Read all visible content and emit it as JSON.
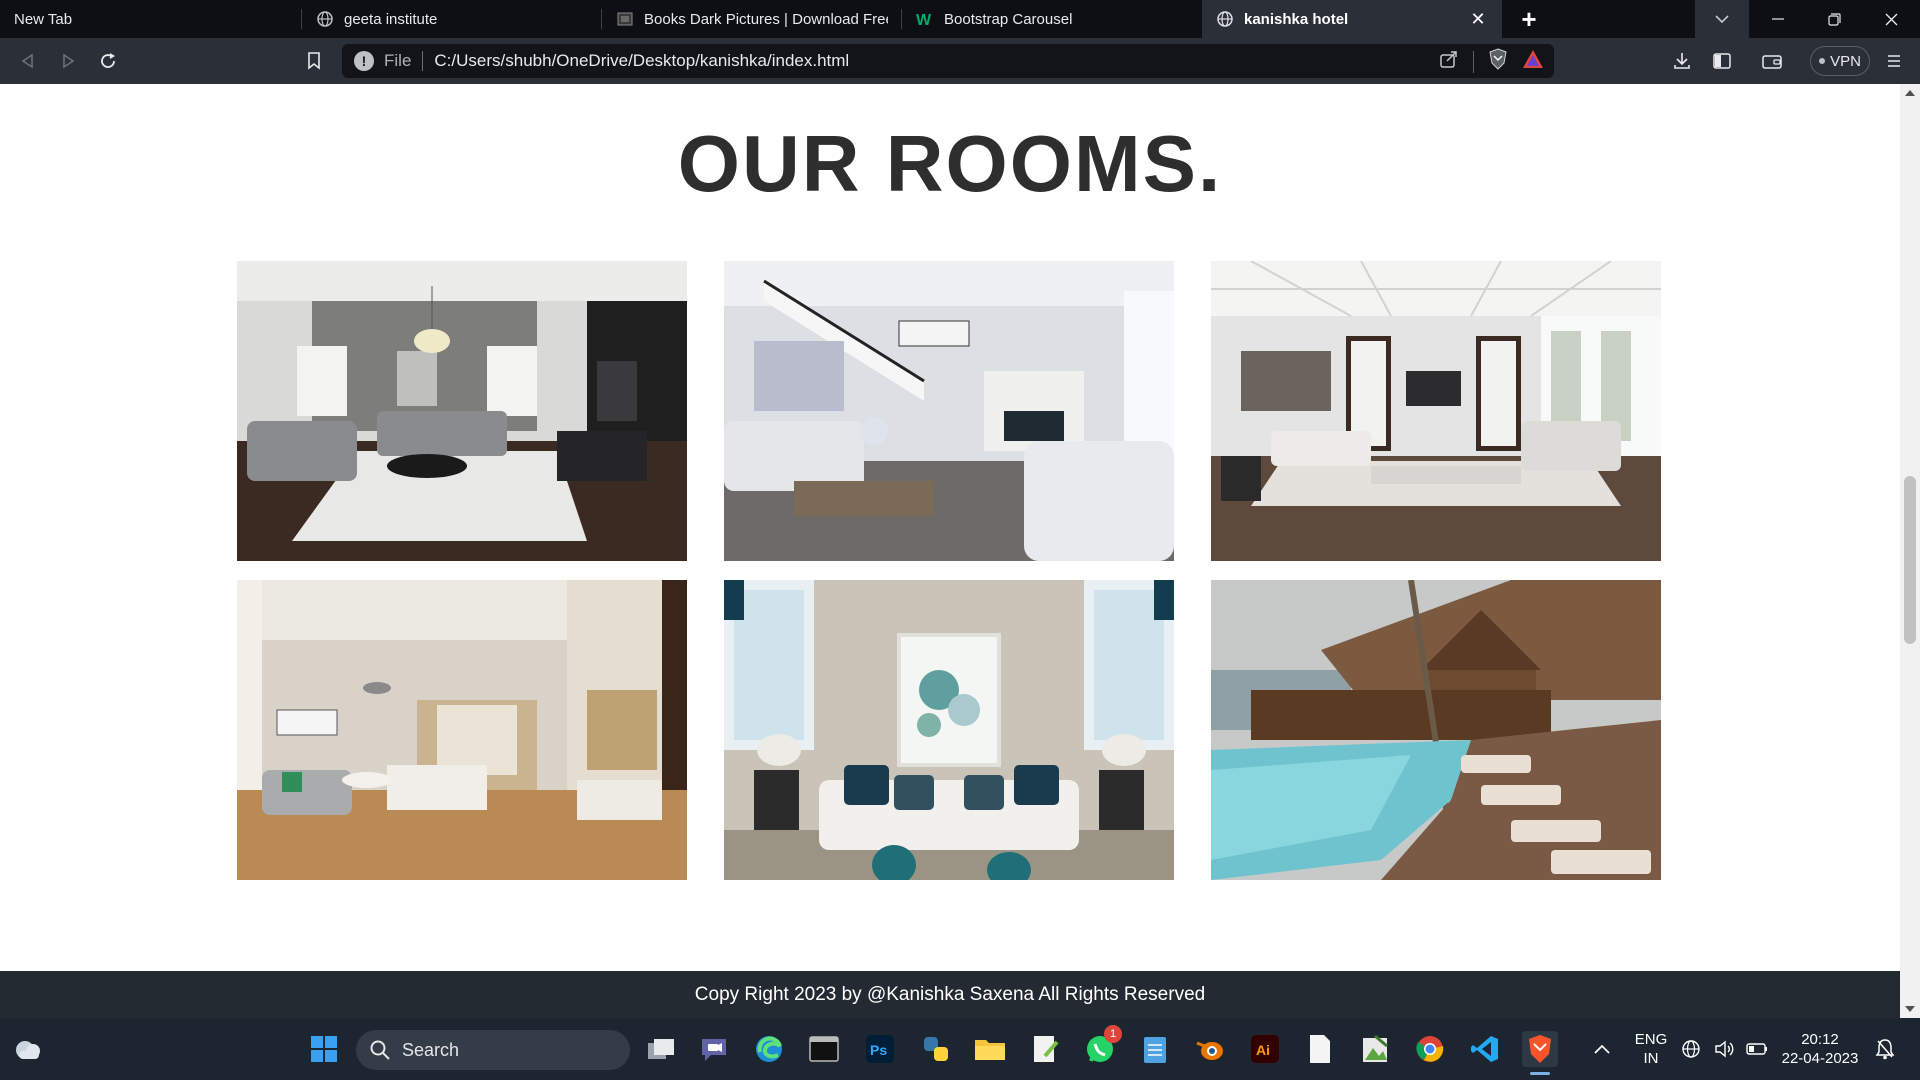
{
  "browser": {
    "tabs": [
      {
        "title": "New Tab",
        "active": false,
        "favicon": "none"
      },
      {
        "title": "geeta institute",
        "active": false,
        "favicon": "globe-icon"
      },
      {
        "title": "Books Dark Pictures | Download Free I",
        "active": false,
        "favicon": "image-site-icon"
      },
      {
        "title": "Bootstrap Carousel",
        "active": false,
        "favicon": "w3schools-icon"
      },
      {
        "title": "kanishka hotel",
        "active": true,
        "favicon": "globe-icon"
      }
    ],
    "address": {
      "scheme": "File",
      "path": "C:/Users/shubh/OneDrive/Desktop/kanishka/index.html"
    },
    "vpn_label": "VPN"
  },
  "page": {
    "heading": "OUR ROOMS.",
    "rooms": [
      {
        "name": "living-room-grey-sofas"
      },
      {
        "name": "living-room-staircase"
      },
      {
        "name": "living-room-coffered-ceiling"
      },
      {
        "name": "hotel-bedroom"
      },
      {
        "name": "sofa-with-painting"
      },
      {
        "name": "resort-pool"
      }
    ],
    "footer": "Copy Right 2023 by @Kanishka Saxena All Rights Reserved"
  },
  "taskbar": {
    "search_placeholder": "Search",
    "whatsapp_badge": "1",
    "language": "ENG",
    "region": "IN",
    "time": "20:12",
    "date": "22-04-2023"
  }
}
